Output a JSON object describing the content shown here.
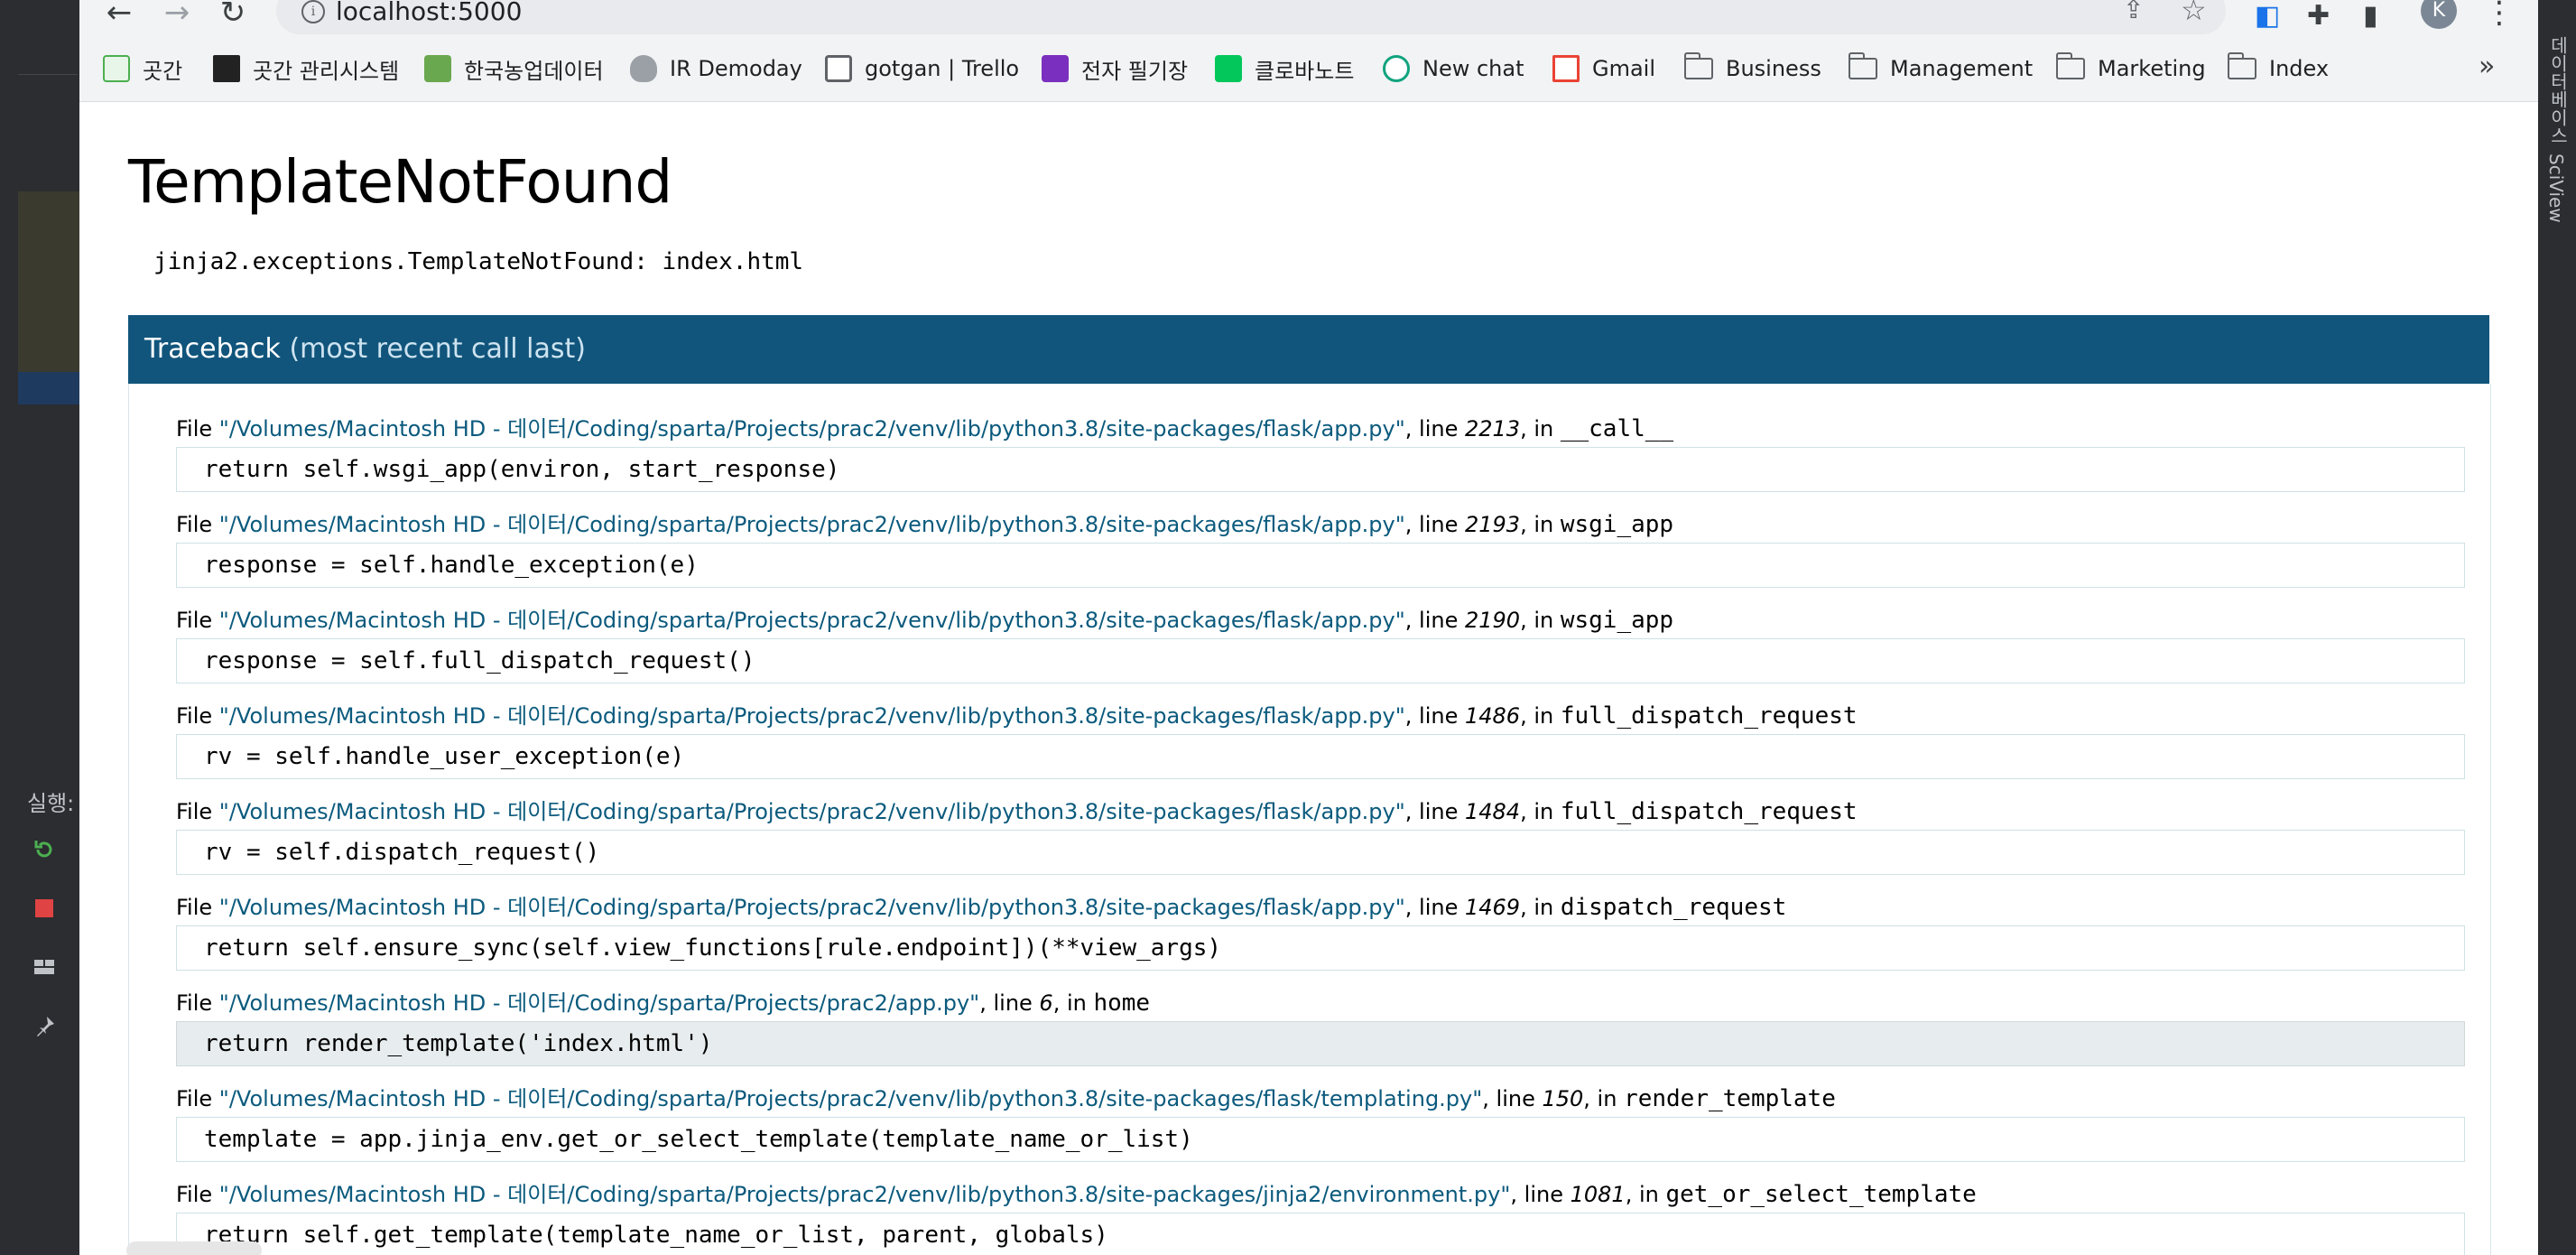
{
  "browser": {
    "url": "localhost:5000",
    "avatar_letter": "K",
    "bookmarks": [
      {
        "label": "곳간",
        "icon": "gotgan-icon",
        "color": "#4caf50"
      },
      {
        "label": "곳간 관리시스템",
        "icon": "gotgan-admin-icon",
        "color": "#222222"
      },
      {
        "label": "한국농업데이터",
        "icon": "agri-data-icon",
        "color": "#6aa84f"
      },
      {
        "label": "IR Demoday",
        "icon": "microphone-icon",
        "color": "#5f6368"
      },
      {
        "label": "gotgan | Trello",
        "icon": "trello-icon",
        "color": "#5f6368"
      },
      {
        "label": "전자 필기장",
        "icon": "onenote-icon",
        "color": "#7b2fbe"
      },
      {
        "label": "클로바노트",
        "icon": "clova-icon",
        "color": "#03c75a"
      },
      {
        "label": "New chat",
        "icon": "chatgpt-icon",
        "color": "#10a37f"
      },
      {
        "label": "Gmail",
        "icon": "gmail-icon",
        "color": "#ea4335"
      },
      {
        "label": "Business",
        "icon": "folder-icon"
      },
      {
        "label": "Management",
        "icon": "folder-icon"
      },
      {
        "label": "Marketing",
        "icon": "folder-icon"
      },
      {
        "label": "Index",
        "icon": "folder-icon"
      }
    ],
    "more_label": "»"
  },
  "page": {
    "title": "TemplateNotFound",
    "error": "jinja2.exceptions.TemplateNotFound: index.html",
    "traceback_title": "Traceback",
    "traceback_sub": "(most recent call last)",
    "frames": [
      {
        "file": "\"/Volumes/Macintosh HD - 데이터/Coding/sparta/Projects/prac2/venv/lib/python3.8/site-packages/flask/app.py\"",
        "line": "2213",
        "func": "__call__",
        "code": "return self.wsgi_app(environ, start_response)"
      },
      {
        "file": "\"/Volumes/Macintosh HD - 데이터/Coding/sparta/Projects/prac2/venv/lib/python3.8/site-packages/flask/app.py\"",
        "line": "2193",
        "func": "wsgi_app",
        "code": "response = self.handle_exception(e)"
      },
      {
        "file": "\"/Volumes/Macintosh HD - 데이터/Coding/sparta/Projects/prac2/venv/lib/python3.8/site-packages/flask/app.py\"",
        "line": "2190",
        "func": "wsgi_app",
        "code": "response = self.full_dispatch_request()"
      },
      {
        "file": "\"/Volumes/Macintosh HD - 데이터/Coding/sparta/Projects/prac2/venv/lib/python3.8/site-packages/flask/app.py\"",
        "line": "1486",
        "func": "full_dispatch_request",
        "code": "rv = self.handle_user_exception(e)"
      },
      {
        "file": "\"/Volumes/Macintosh HD - 데이터/Coding/sparta/Projects/prac2/venv/lib/python3.8/site-packages/flask/app.py\"",
        "line": "1484",
        "func": "full_dispatch_request",
        "code": "rv = self.dispatch_request()"
      },
      {
        "file": "\"/Volumes/Macintosh HD - 데이터/Coding/sparta/Projects/prac2/venv/lib/python3.8/site-packages/flask/app.py\"",
        "line": "1469",
        "func": "dispatch_request",
        "code": "return self.ensure_sync(self.view_functions[rule.endpoint])(**view_args)"
      },
      {
        "file": "\"/Volumes/Macintosh HD - 데이터/Coding/sparta/Projects/prac2/app.py\"",
        "line": "6",
        "func": "home",
        "code": "return render_template('index.html')",
        "highlight": true
      },
      {
        "file": "\"/Volumes/Macintosh HD - 데이터/Coding/sparta/Projects/prac2/venv/lib/python3.8/site-packages/flask/templating.py\"",
        "line": "150",
        "func": "render_template",
        "code": "template = app.jinja_env.get_or_select_template(template_name_or_list)"
      },
      {
        "file": "\"/Volumes/Macintosh HD - 데이터/Coding/sparta/Projects/prac2/venv/lib/python3.8/site-packages/jinja2/environment.py\"",
        "line": "1081",
        "func": "get_or_select_template",
        "code": "return self.get_template(template_name_or_list, parent, globals)"
      }
    ]
  },
  "ide": {
    "run_label": "실행:",
    "right_tabs": [
      "데이터베이스",
      "SciView"
    ]
  }
}
